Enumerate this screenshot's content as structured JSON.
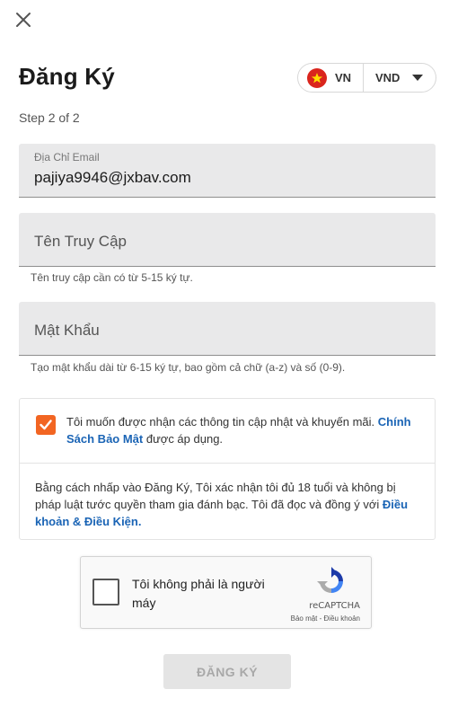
{
  "form": {
    "title": "Đăng Ký",
    "step": "Step 2 of 2"
  },
  "locale": {
    "country_code": "VN",
    "currency": "VND",
    "flag_color": "#da251d"
  },
  "fields": {
    "email": {
      "label": "Địa Chỉ Email",
      "value": "pajiya9946@jxbav.com"
    },
    "username": {
      "placeholder": "Tên Truy Cập",
      "hint": "Tên truy cập cần có từ 5-15 ký tự."
    },
    "password": {
      "placeholder": "Mật Khẩu",
      "hint": "Tạo mật khẩu dài từ 6-15 ký tự, bao gồm cả chữ (a-z) và số (0-9)."
    }
  },
  "consent": {
    "promo_text": "Tôi muốn được nhận các thông tin cập nhật và khuyến mãi. ",
    "privacy_link": "Chính Sách Bảo Mật",
    "promo_suffix": " được áp dụng.",
    "checked": true,
    "terms_text": "Bằng cách nhấp vào Đăng Ký, Tôi xác nhận tôi đủ 18 tuổi và không bị pháp luật tước quyền tham gia đánh bạc. Tôi đã đọc và đồng ý với ",
    "terms_link": "Điều khoản & Điều Kiện."
  },
  "captcha": {
    "label": "Tôi không phải là người máy",
    "brand": "reCAPTCHA",
    "privacy": "Bảo mật",
    "separator": " - ",
    "terms": "Điều khoản"
  },
  "submit": {
    "label": "ĐĂNG KÝ"
  },
  "colors": {
    "accent_orange": "#f26522",
    "link_blue": "#1a64b5",
    "field_bg": "#e9e9ea"
  }
}
